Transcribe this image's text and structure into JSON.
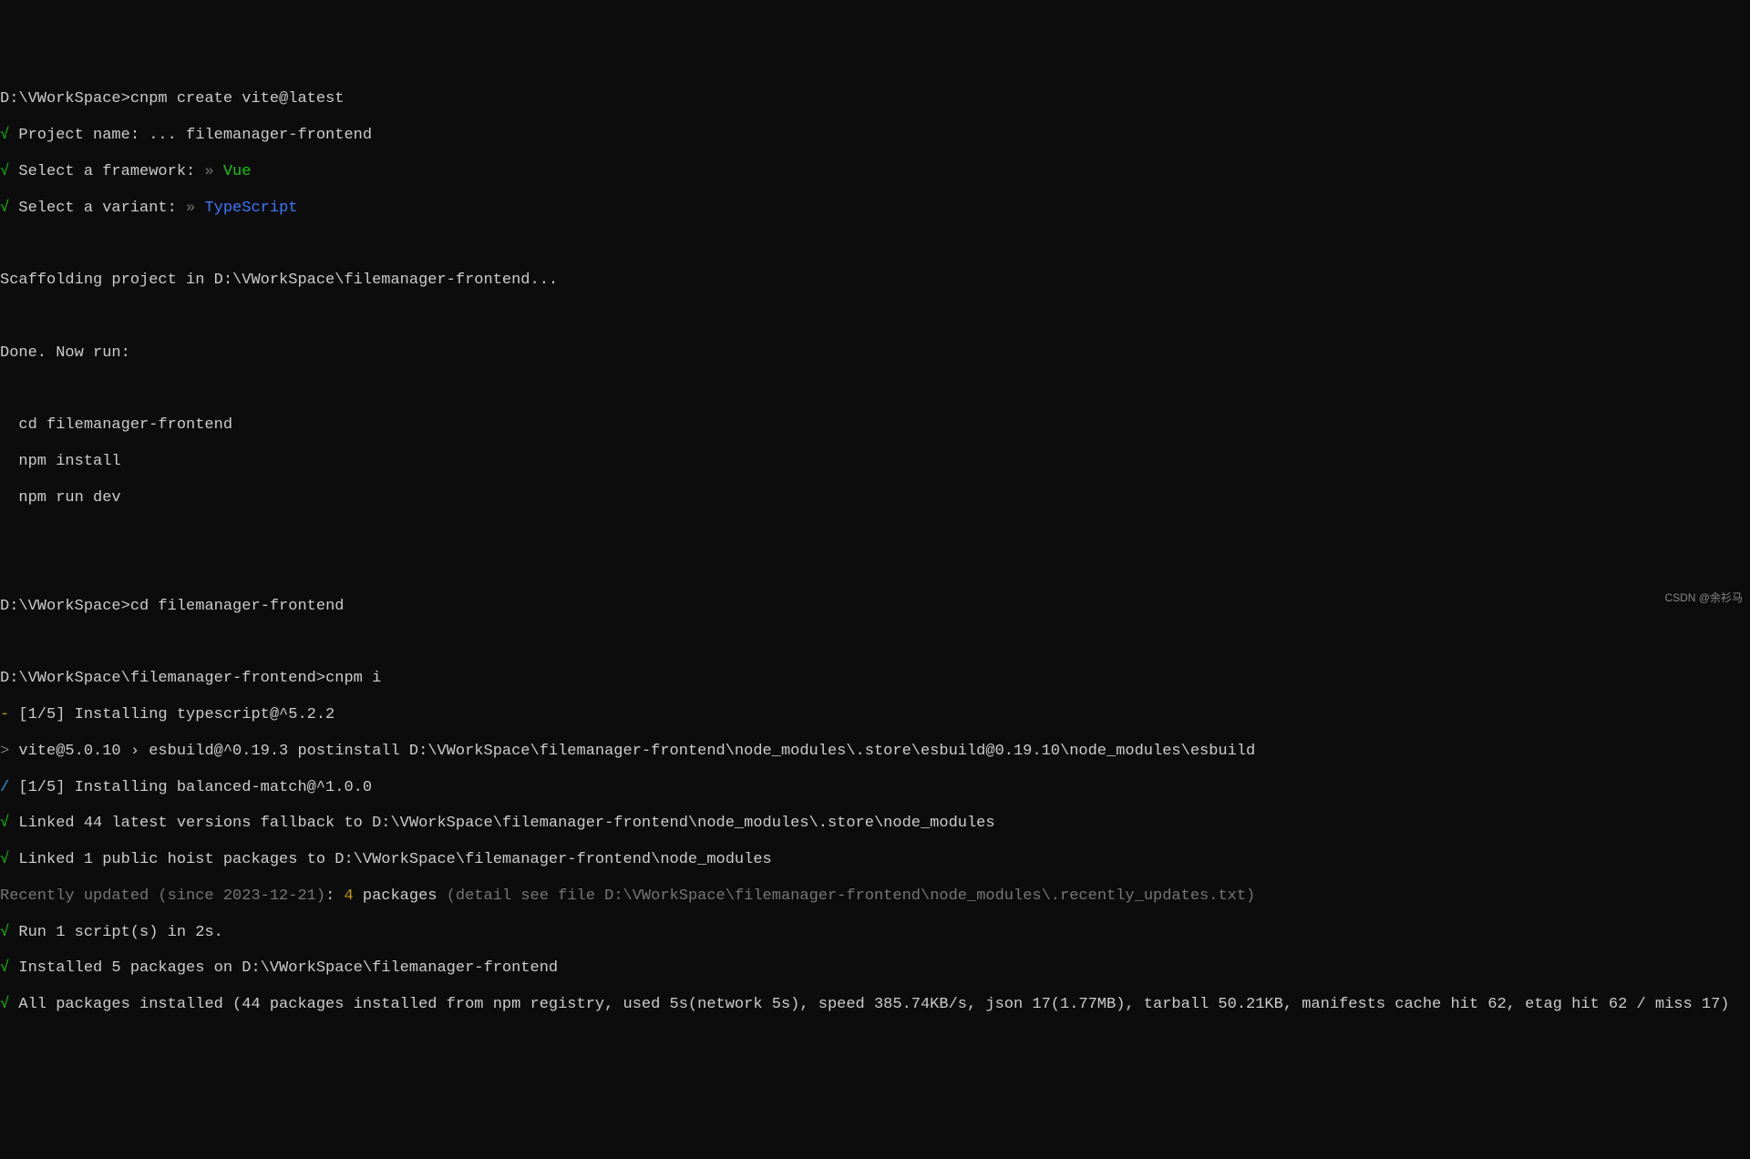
{
  "lines": {
    "l1_prompt": "D:\\VWorkSpace>",
    "l1_cmd": "cnpm create vite@latest",
    "l2_check": "√",
    "l2_text": " Project name: ... filemanager-frontend",
    "l3_check": "√",
    "l3_text": " Select a framework: ",
    "l3_chevron": "»",
    "l3_value": " Vue",
    "l4_check": "√",
    "l4_text": " Select a variant: ",
    "l4_chevron": "»",
    "l4_value": " TypeScript",
    "l6": "Scaffolding project in D:\\VWorkSpace\\filemanager-frontend...",
    "l8": "Done. Now run:",
    "l10": "  cd filemanager-frontend",
    "l11": "  npm install",
    "l12": "  npm run dev",
    "l15_prompt": "D:\\VWorkSpace>",
    "l15_cmd": "cd filemanager-frontend",
    "l17_prompt": "D:\\VWorkSpace\\filemanager-frontend>",
    "l17_cmd": "cnpm i",
    "l18_dash": "-",
    "l18_text": " [1/5] Installing typescript@^5.2.2",
    "l19_chevron": ">",
    "l19_text": " vite@5.0.10 › esbuild@^0.19.3 postinstall D:\\VWorkSpace\\filemanager-frontend\\node_modules\\.store\\esbuild@0.19.10\\node_modules\\esbuild",
    "l20_slash": "/",
    "l20_text": " [1/5] Installing balanced-match@^1.0.0",
    "l21_check": "√",
    "l21_text": " Linked 44 latest versions fallback to D:\\VWorkSpace\\filemanager-frontend\\node_modules\\.store\\node_modules",
    "l22_check": "√",
    "l22_text": " Linked 1 public hoist packages to D:\\VWorkSpace\\filemanager-frontend\\node_modules",
    "l23_gray1": "Recently updated (since 2023-12-21)",
    "l23_colon": ": ",
    "l23_count": "4",
    "l23_pkg": " packages",
    "l23_gray2": " (detail see file D:\\VWorkSpace\\filemanager-frontend\\node_modules\\.recently_updates.txt)",
    "l24_check": "√",
    "l24_text": " Run 1 script(s) in 2s.",
    "l25_check": "√",
    "l25_text": " Installed 5 packages on D:\\VWorkSpace\\filemanager-frontend",
    "l26_check": "√",
    "l26_text": " All packages installed (44 packages installed from npm registry, used 5s(network 5s), speed 385.74KB/s, json 17(1.77MB), tarball 50.21KB, manifests cache hit 62, etag hit 62 / miss 17)"
  },
  "watermark": "CSDN @余衫马"
}
